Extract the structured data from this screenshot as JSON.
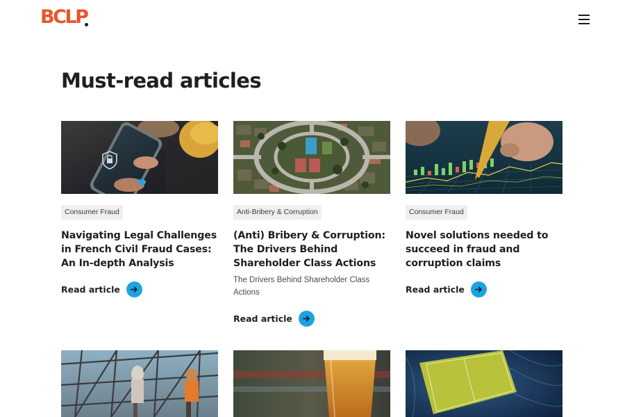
{
  "header": {
    "logo_text": "BCLP",
    "menu_icon": "hamburger-menu-icon"
  },
  "main": {
    "title": "Must-read articles",
    "articles": [
      {
        "tag": "Consumer Fraud",
        "title": "Navigating Legal Challenges in French Civil Fraud Cases: An In-depth Analysis",
        "description": "",
        "link_label": "Read article",
        "image": "phone-with-lock-icon-photo"
      },
      {
        "tag": "Anti-Bribery & Corruption",
        "title": "(Anti) Bribery & Corruption: The Drivers Behind Shareholder Class Actions",
        "description": "The Drivers Behind Shareholder Class Actions",
        "link_label": "Read article",
        "image": "aerial-neighborhood-roundabout-photo"
      },
      {
        "tag": "Consumer Fraud",
        "title": "Novel solutions needed to succeed in fraud and corruption claims",
        "description": "",
        "link_label": "Read article",
        "image": "pen-over-financial-chart-photo"
      }
    ],
    "more_images": [
      "construction-workers-scaffolding-photo",
      "beer-glass-photo",
      "football-stadium-aerial-photo"
    ]
  },
  "colors": {
    "brand_orange": "#e8552a",
    "accent_blue": "#1ba4e2",
    "tag_background": "#efefef",
    "text_dark": "#1f1f1f"
  }
}
